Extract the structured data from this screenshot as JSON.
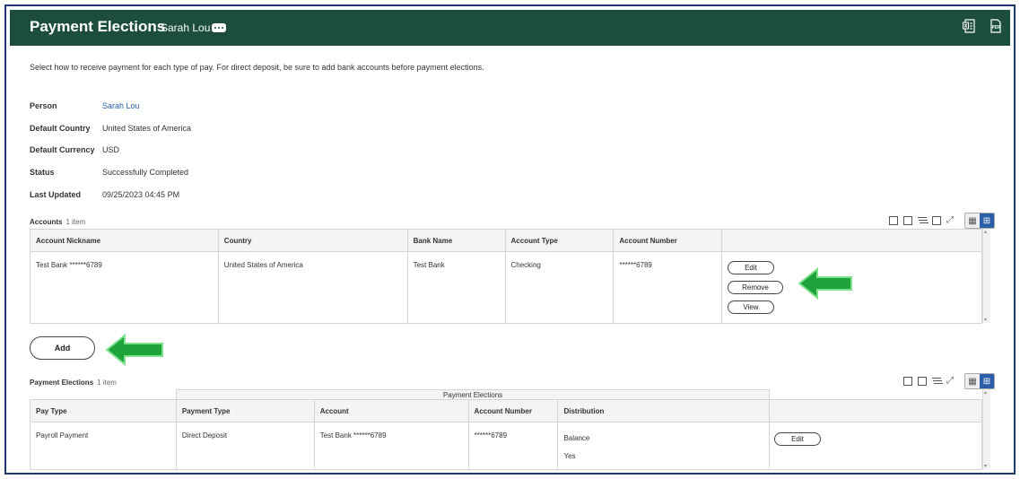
{
  "header": {
    "title": "Payment Elections",
    "person": "Sarah Lou",
    "icons": [
      "export-excel-icon",
      "export-pdf-icon"
    ]
  },
  "intro": "Select how to receive payment for each type of pay. For direct deposit, be sure to add bank accounts before payment elections.",
  "fields": [
    {
      "label": "Person",
      "value": "Sarah Lou"
    },
    {
      "label": "Default Country",
      "value": "United States of America"
    },
    {
      "label": "Default Currency",
      "value": "USD"
    },
    {
      "label": "Status",
      "value": "Successfully Completed"
    },
    {
      "label": "Last Updated",
      "value": "09/25/2023 04:45 PM"
    }
  ],
  "accounts": {
    "title": "Accounts",
    "count": "1 item",
    "columns": [
      "Account Nickname",
      "Country",
      "Bank Name",
      "Account Type",
      "Account Number",
      ""
    ],
    "rows": [
      {
        "nickname": "Test Bank ******6789",
        "country": "United States of America",
        "bank": "Test Bank",
        "type": "Checking",
        "number": "******6789"
      }
    ],
    "actions": {
      "edit": "Edit",
      "remove": "Remove",
      "view": "View"
    },
    "add_label": "Add"
  },
  "payment_elections": {
    "title": "Payment Elections",
    "count": "1 item",
    "group_header": "Payment Elections",
    "columns": [
      "Pay Type",
      "Payment Type",
      "Account",
      "Account Number",
      "Distribution",
      ""
    ],
    "rows": [
      {
        "pay_type": "Payroll Payment",
        "payment_type": "Direct Deposit",
        "account": "Test Bank ******6789",
        "account_number": "******6789",
        "distribution": "Balance",
        "distribution_flag": "Yes"
      }
    ],
    "edit_label": "Edit"
  },
  "colors": {
    "header_bg": "#1d4d3e",
    "link": "#2b5ea8",
    "arrow": "#1ea33a"
  }
}
